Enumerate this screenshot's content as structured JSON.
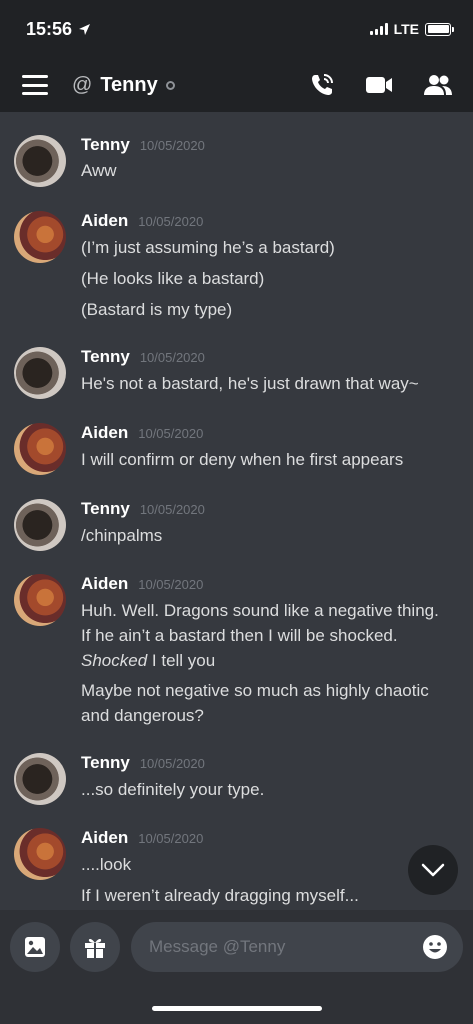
{
  "status_bar": {
    "time": "15:56",
    "network": "LTE"
  },
  "header": {
    "at_symbol": "@",
    "channel_name": "Tenny"
  },
  "messages": [
    {
      "author": "Tenny",
      "timestamp": "10/05/2020",
      "lines": [
        "Aww"
      ]
    },
    {
      "author": "Aiden",
      "timestamp": "10/05/2020",
      "lines": [
        "(I’m just assuming he’s a bastard)",
        "(He looks like a bastard)",
        "(Bastard is my type)"
      ]
    },
    {
      "author": "Tenny",
      "timestamp": "10/05/2020",
      "lines": [
        "He's not a bastard, he's just drawn that way~"
      ]
    },
    {
      "author": "Aiden",
      "timestamp": "10/05/2020",
      "lines": [
        "I will confirm or deny when he first appears"
      ]
    },
    {
      "author": "Tenny",
      "timestamp": "10/05/2020",
      "lines": [
        "/chinpalms"
      ]
    },
    {
      "author": "Aiden",
      "timestamp": "10/05/2020",
      "lines": [
        "Huh. Well. Dragons sound like a negative thing.",
        "If he ain’t a bastard then I will be shocked.",
        "Shocked",
        " I tell you",
        "Maybe not negative so much as highly chaotic",
        "and dangerous?"
      ]
    },
    {
      "author": "Tenny",
      "timestamp": "10/05/2020",
      "lines": [
        "...so definitely your type."
      ]
    },
    {
      "author": "Aiden",
      "timestamp": "10/05/2020",
      "lines": [
        "....look",
        "If I weren’t already dragging myself..."
      ]
    }
  ],
  "composer": {
    "placeholder": "Message @Tenny"
  },
  "icons": {
    "menu": "hamburger-menu-icon",
    "call": "phone-call-icon",
    "video": "video-camera-icon",
    "members": "members-icon",
    "image": "image-icon",
    "gift": "gift-icon",
    "emoji": "emoji-icon",
    "scroll": "chevron-down-icon"
  },
  "colors": {
    "background": "#36393f",
    "header": "#202225",
    "composer": "#2f3136",
    "input": "#40444b"
  }
}
